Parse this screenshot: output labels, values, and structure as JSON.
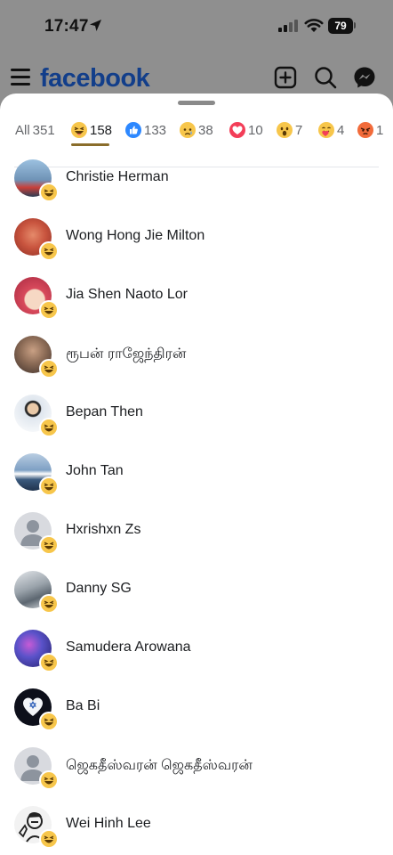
{
  "status_bar": {
    "time": "17:47",
    "battery": "79"
  },
  "app_bar": {
    "brand": "facebook",
    "brand_color": "#123e8a",
    "icons": [
      "menu-icon",
      "add-post-icon",
      "search-icon",
      "messenger-icon"
    ]
  },
  "reaction_tabs": [
    {
      "label": "All",
      "count": "351",
      "emoji": null,
      "active": false
    },
    {
      "label": "",
      "count": "158",
      "emoji": "haha",
      "active": true
    },
    {
      "label": "",
      "count": "133",
      "emoji": "like",
      "active": false
    },
    {
      "label": "",
      "count": "38",
      "emoji": "sad",
      "active": false
    },
    {
      "label": "",
      "count": "10",
      "emoji": "love",
      "active": false
    },
    {
      "label": "",
      "count": "7",
      "emoji": "wow",
      "active": false
    },
    {
      "label": "",
      "count": "4",
      "emoji": "care",
      "active": false
    },
    {
      "label": "",
      "count": "1",
      "emoji": "angry",
      "active": false
    }
  ],
  "people": [
    {
      "name": "Christie Herman",
      "avatar_color": "#6f93b6",
      "reaction": "haha"
    },
    {
      "name": "Wong Hong Jie Milton",
      "avatar_color": "#c9553f",
      "reaction": "haha"
    },
    {
      "name": "Jia Shen Naoto Lor",
      "avatar_color": "#d84a5c",
      "reaction": "haha"
    },
    {
      "name": "ரூபன் ராஜேந்திரன்",
      "avatar_color": "#8a6a55",
      "reaction": "haha"
    },
    {
      "name": "Bepan Then",
      "avatar_color": "#dfe6ee",
      "reaction": "haha"
    },
    {
      "name": "John Tan",
      "avatar_color": "#5a7da3",
      "reaction": "haha"
    },
    {
      "name": "Hxrishxn Zs",
      "avatar_color": "#c8ccd1",
      "reaction": "haha"
    },
    {
      "name": "Danny SG",
      "avatar_color": "#9aa3ab",
      "reaction": "haha"
    },
    {
      "name": "Samudera Arowana",
      "avatar_color": "#3c3f9a",
      "reaction": "haha"
    },
    {
      "name": "Ba Bi",
      "avatar_color": "#0d0f1a",
      "reaction": "haha"
    },
    {
      "name": "ஜெகதீஸ்வரன் ஜெகதீஸ்வரன்",
      "avatar_color": "#c8ccd1",
      "reaction": "haha"
    },
    {
      "name": "Wei Hinh Lee",
      "avatar_color": "#f2f2f2",
      "reaction": "haha"
    }
  ],
  "accent": "#8a6d2b"
}
